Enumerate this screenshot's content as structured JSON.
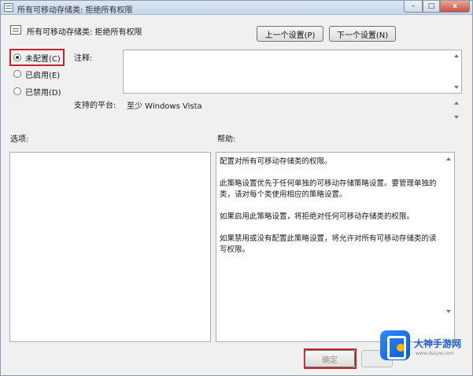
{
  "window": {
    "title": "所有可移动存储类: 拒绝所有权限",
    "buttons": {
      "minimize": "–",
      "maximize": "□",
      "close": "x"
    }
  },
  "header": {
    "policy_title": "所有可移动存储类: 拒绝所有权限",
    "prev_button": "上一个设置(P)",
    "next_button": "下一个设置(N)"
  },
  "state_options": [
    {
      "label": "未配置(C)",
      "checked": true
    },
    {
      "label": "已启用(E)",
      "checked": false
    },
    {
      "label": "已禁用(D)",
      "checked": false
    }
  ],
  "comment": {
    "label": "注释:",
    "value": ""
  },
  "platform": {
    "label": "支持的平台:",
    "value": "至少 Windows Vista"
  },
  "options": {
    "label": "选项:"
  },
  "help": {
    "label": "帮助:",
    "paragraphs": [
      "配置对所有可移动存储类的权限。",
      "此策略设置优先于任何单独的可移动存储策略设置。要管理单独的类，请对每个类使用相应的策略设置。",
      "如果启用此策略设置，将拒绝对任何可移动存储类的权限。",
      "如果禁用或没有配置此策略设置，将允许对所有可移动存储类的读写权限。"
    ]
  },
  "footer": {
    "ok_button": "确定",
    "cancel_button": ""
  },
  "watermark": {
    "name": "大神手游网",
    "url": "www.dssyw.com"
  },
  "colors": {
    "highlight": "#c0262c"
  },
  "icons": {
    "window": "policy-icon",
    "radio": "radio-button"
  }
}
